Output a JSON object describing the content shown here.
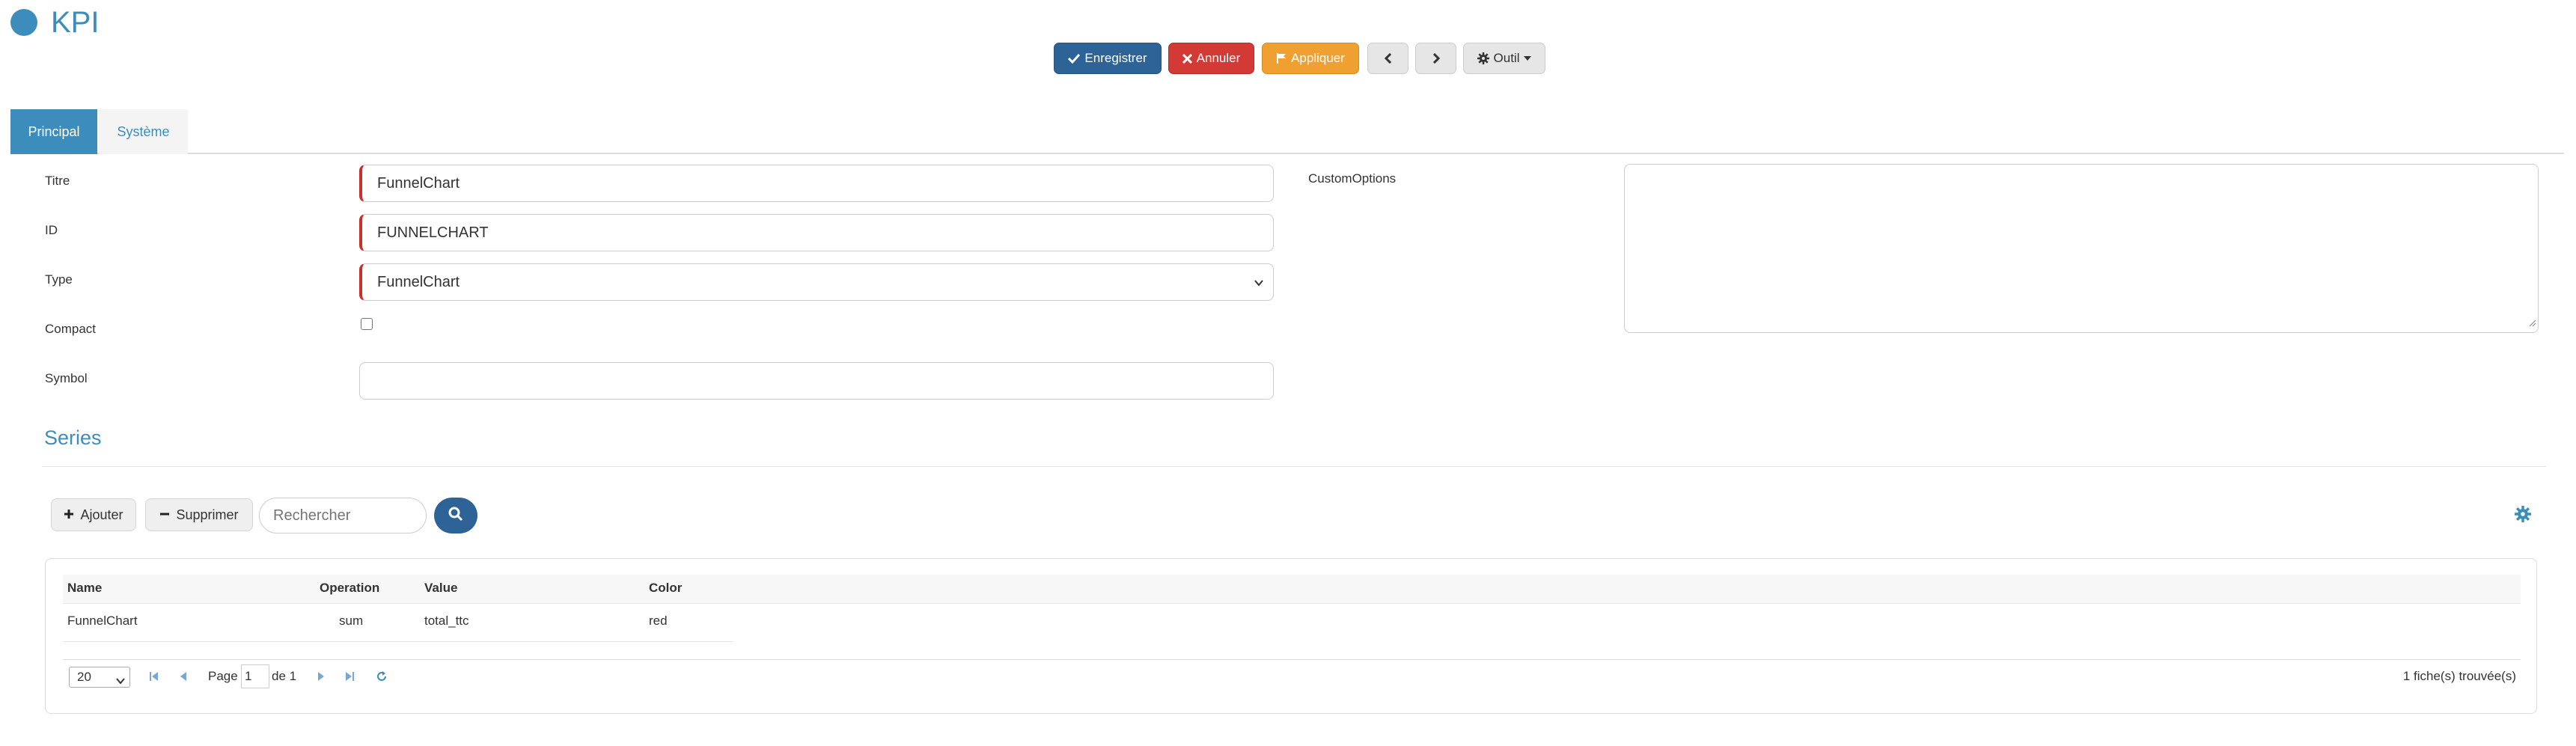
{
  "header": {
    "title": "KPI"
  },
  "toolbar": {
    "save_label": "Enregistrer",
    "cancel_label": "Annuler",
    "apply_label": "Appliquer",
    "tool_label": "Outil"
  },
  "tabs": [
    {
      "label": "Principal",
      "active": true
    },
    {
      "label": "Système",
      "active": false
    }
  ],
  "form": {
    "titre_label": "Titre",
    "titre_value": "FunnelChart",
    "id_label": "ID",
    "id_value": "FUNNELCHART",
    "type_label": "Type",
    "type_value": "FunnelChart",
    "compact_label": "Compact",
    "compact_checked": false,
    "symbol_label": "Symbol",
    "symbol_value": "",
    "custom_options_label": "CustomOptions",
    "custom_options_value": ""
  },
  "series": {
    "title": "Series",
    "add_label": "Ajouter",
    "delete_label": "Supprimer",
    "search_placeholder": "Rechercher",
    "columns": [
      "Name",
      "Operation",
      "Value",
      "Color"
    ],
    "rows": [
      {
        "name": "FunnelChart",
        "operation": "sum",
        "value": "total_ttc",
        "color": "red"
      }
    ],
    "pager": {
      "page_size": "20",
      "page_label": "Page",
      "page_current": "1",
      "of_label": "de 1",
      "records_found": "1 fiche(s) trouvée(s)"
    }
  },
  "colors": {
    "primary": "#3c8dbc",
    "save": "#2d6397",
    "cancel": "#d33a36",
    "apply": "#f0a030",
    "required": "#c9302c"
  },
  "icons": [
    "check-icon",
    "times-icon",
    "flag-icon",
    "chevron-left-icon",
    "chevron-right-icon",
    "gear-icon",
    "plus-icon",
    "minus-icon",
    "search-icon",
    "first-page-icon",
    "prev-page-icon",
    "next-page-icon",
    "last-page-icon",
    "refresh-icon"
  ]
}
